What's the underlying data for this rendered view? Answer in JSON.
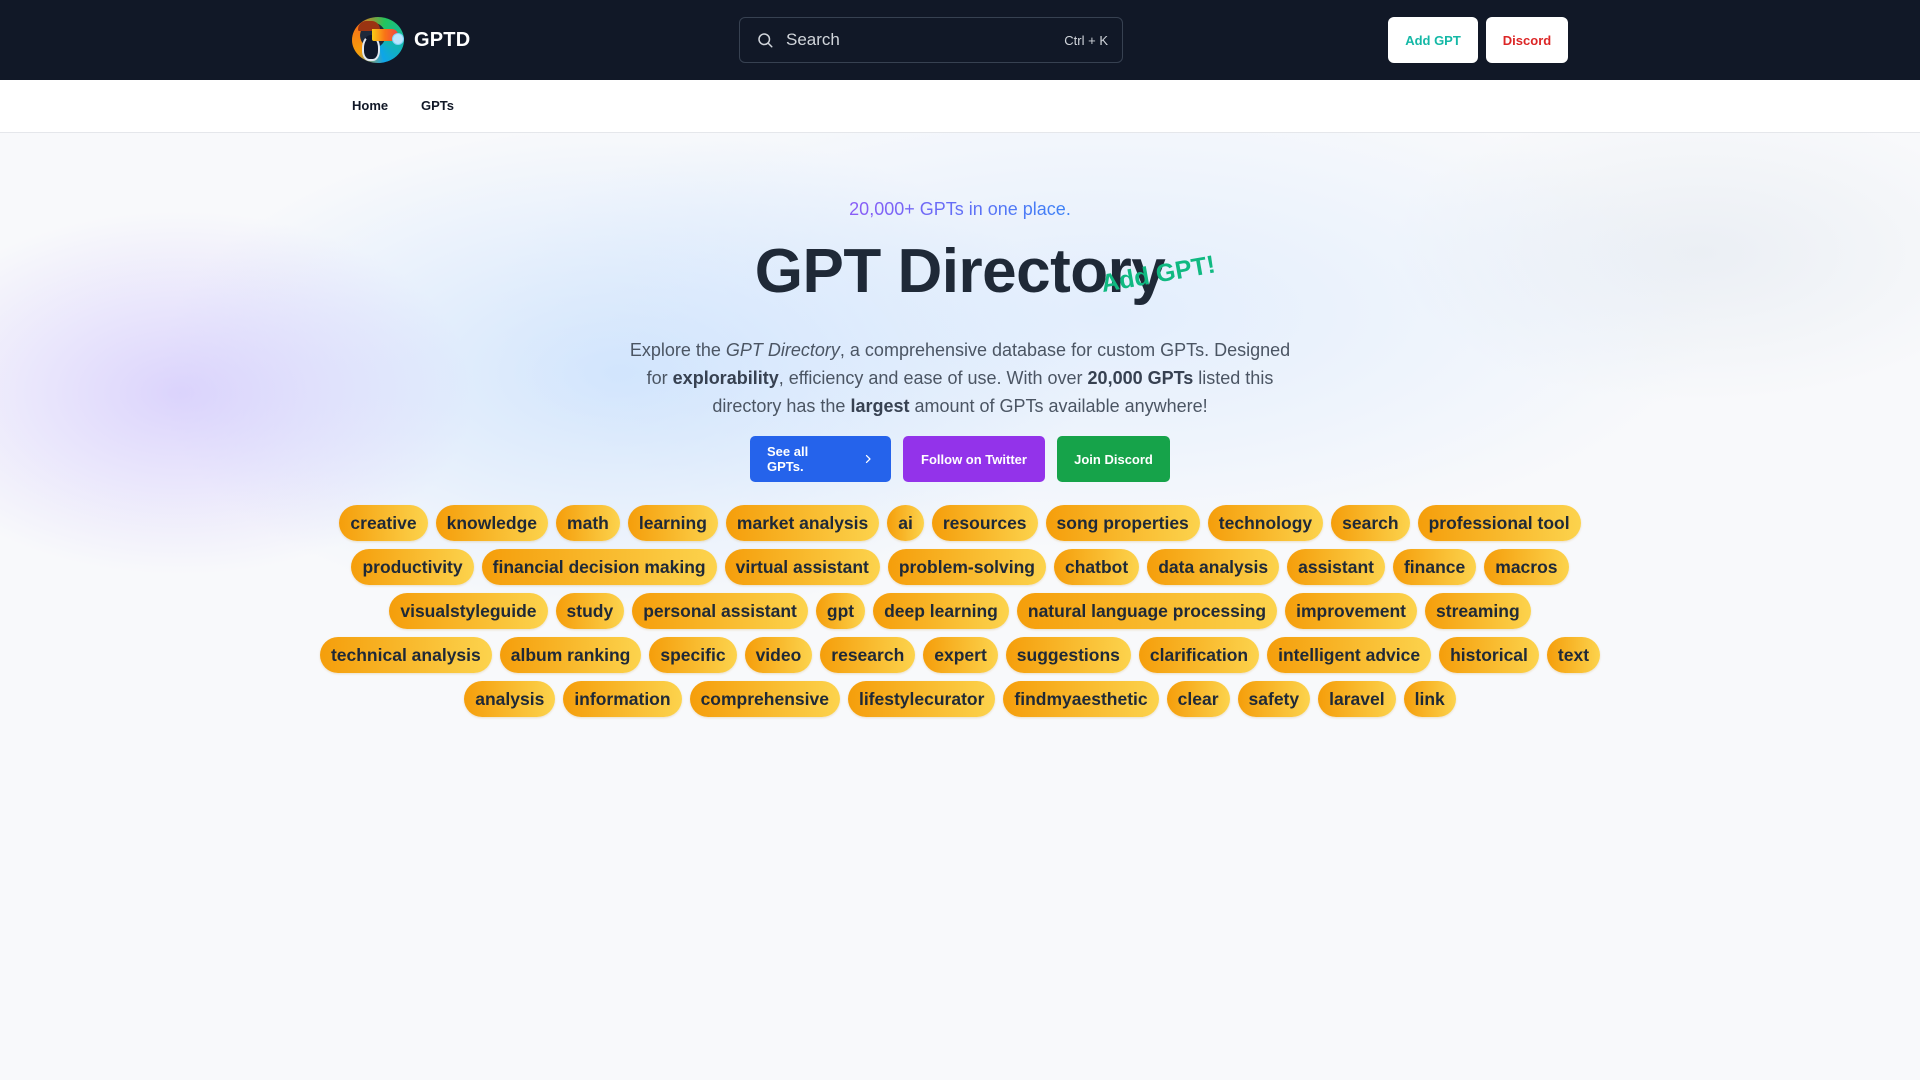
{
  "header": {
    "brand": "GPTD",
    "search": {
      "placeholder": "Search",
      "shortcut": "Ctrl + K"
    },
    "buttons": {
      "add_gpt": "Add GPT",
      "discord": "Discord"
    },
    "colors": {
      "background": "#111827",
      "add_gpt_text": "#14b8a6",
      "discord_text": "#dc2626"
    }
  },
  "nav": {
    "items": [
      {
        "label": "Home"
      },
      {
        "label": "GPTs"
      }
    ]
  },
  "hero": {
    "tagline": "20,000+ GPTs in one place.",
    "title": "GPT Directory",
    "add_gpt_callout": "Add GPT!",
    "description": {
      "p1": "Explore the ",
      "italic": "GPT Directory",
      "p2": ", a comprehensive database for custom GPTs. Designed for ",
      "bold1": "explorability",
      "p3": ", efficiency and ease of use. With over ",
      "bold2": "20,000 GPTs",
      "p4": " listed this directory has the ",
      "bold3": "largest",
      "p5": " amount of GPTs available anywhere!"
    },
    "cta": {
      "see_all": "See all GPTs.",
      "twitter": "Follow on Twitter",
      "discord": "Join Discord"
    },
    "colors": {
      "see_all": "#2563eb",
      "twitter": "#9333ea",
      "discord": "#16a34a",
      "callout": "#10b981"
    }
  },
  "tags": [
    "creative",
    "knowledge",
    "math",
    "learning",
    "market analysis",
    "ai",
    "resources",
    "song properties",
    "technology",
    "search",
    "professional tool",
    "productivity",
    "financial decision making",
    "virtual assistant",
    "problem-solving",
    "chatbot",
    "data analysis",
    "assistant",
    "finance",
    "macros",
    "visualstyleguide",
    "study",
    "personal assistant",
    "gpt",
    "deep learning",
    "natural language processing",
    "improvement",
    "streaming",
    "technical analysis",
    "album ranking",
    "specific",
    "video",
    "research",
    "expert",
    "suggestions",
    "clarification",
    "intelligent advice",
    "historical",
    "text",
    "analysis",
    "information",
    "comprehensive",
    "lifestylecurator",
    "findmyaesthetic",
    "clear",
    "safety",
    "laravel",
    "link"
  ]
}
